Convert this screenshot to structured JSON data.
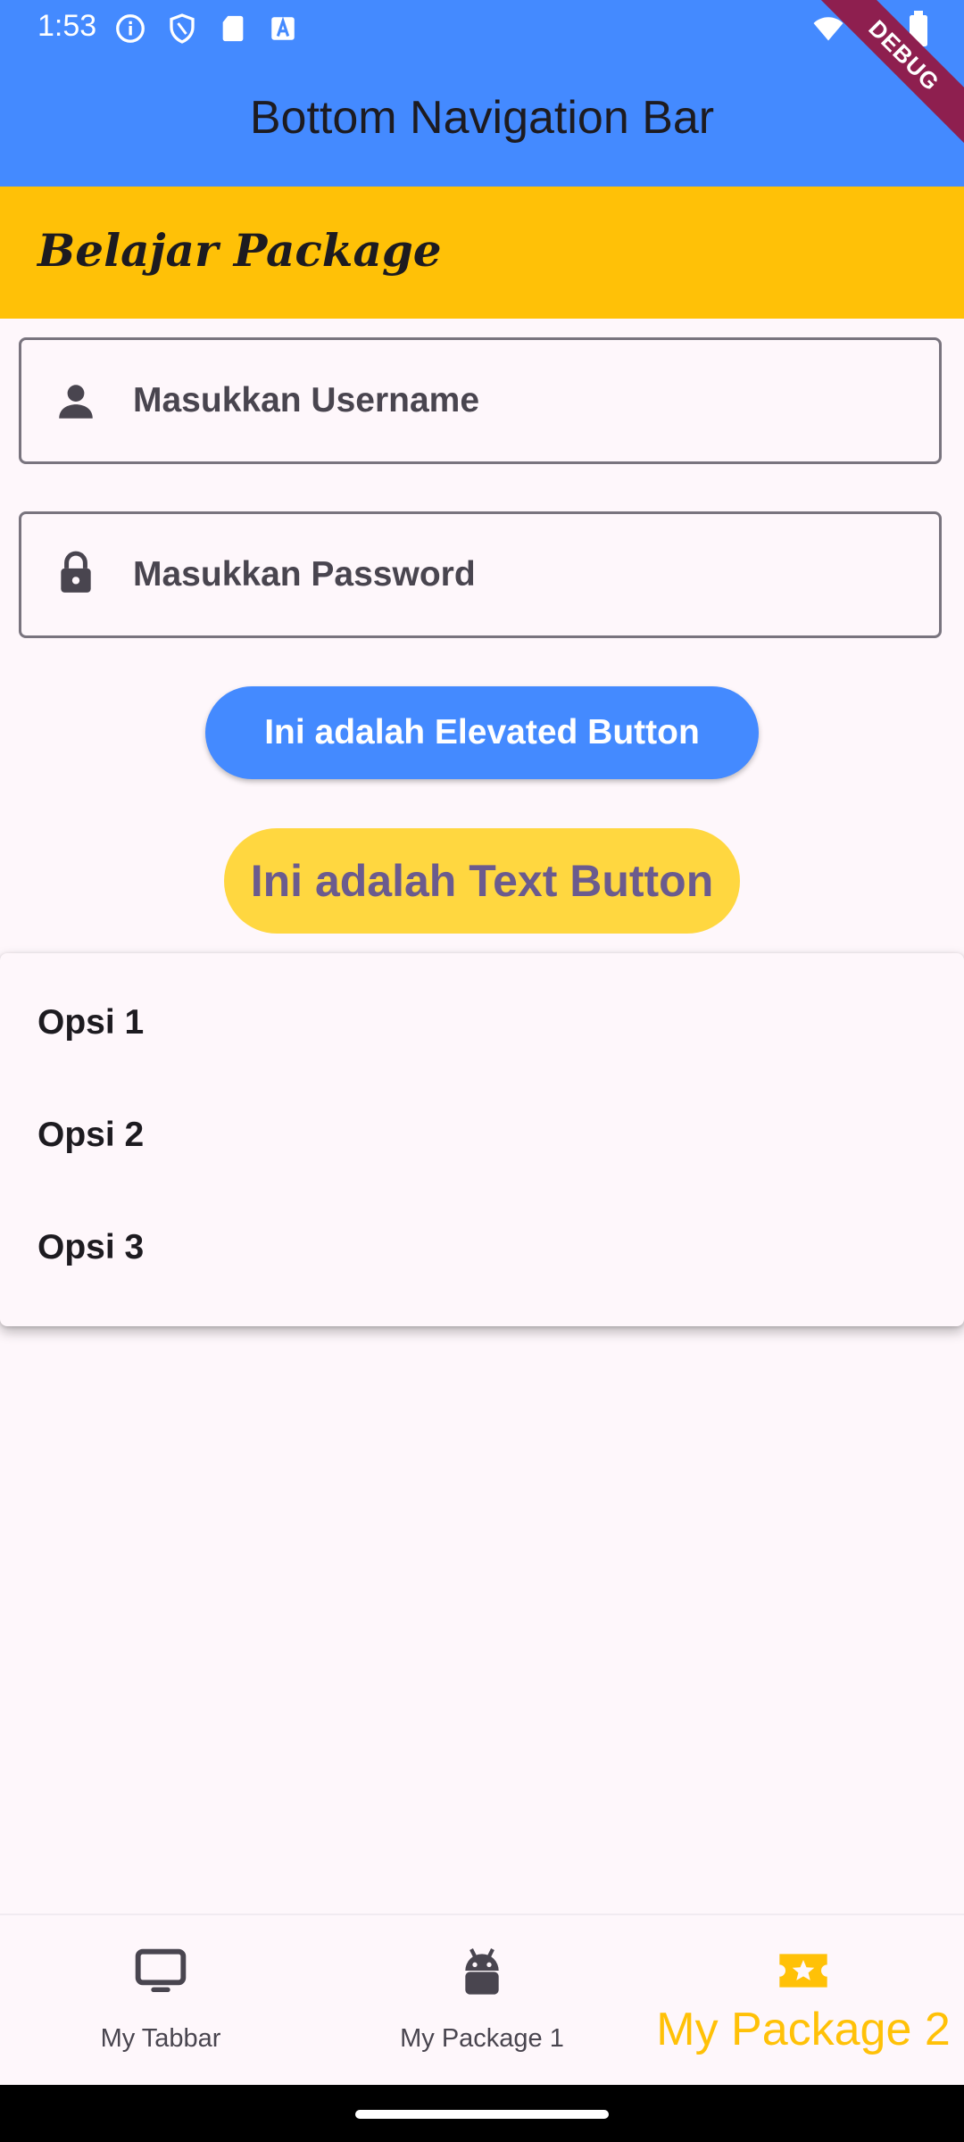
{
  "status_bar": {
    "time": "1:53",
    "left_icons": [
      "info-icon",
      "shield-icon",
      "sd-card-icon",
      "a-icon"
    ],
    "right_icons": [
      "wifi-icon",
      "signal-icon",
      "battery-icon"
    ]
  },
  "app_bar": {
    "title": "Bottom Navigation Bar"
  },
  "debug_banner": "DEBUG",
  "header": {
    "title": "Belajar Package",
    "background": "#ffc107"
  },
  "form": {
    "username": {
      "placeholder": "Masukkan Username",
      "icon": "person-icon"
    },
    "password": {
      "placeholder": "Masukkan Password",
      "icon": "lock-icon"
    }
  },
  "buttons": {
    "elevated": "Ini adalah Elevated Button",
    "text": "Ini adalah Text Button"
  },
  "dropdown_menu": {
    "items": [
      "Opsi 1",
      "Opsi 2",
      "Opsi 3"
    ]
  },
  "bottom_nav": {
    "items": [
      {
        "label": "My Tabbar",
        "icon": "tv-icon"
      },
      {
        "label": "My Package 1",
        "icon": "android-icon"
      },
      {
        "label": "My Package 2",
        "icon": "ticket-star-icon"
      }
    ],
    "selected": "My Package 2"
  },
  "colors": {
    "primary": "#448aff",
    "accent": "#ffc107",
    "background": "#fef7fb"
  }
}
